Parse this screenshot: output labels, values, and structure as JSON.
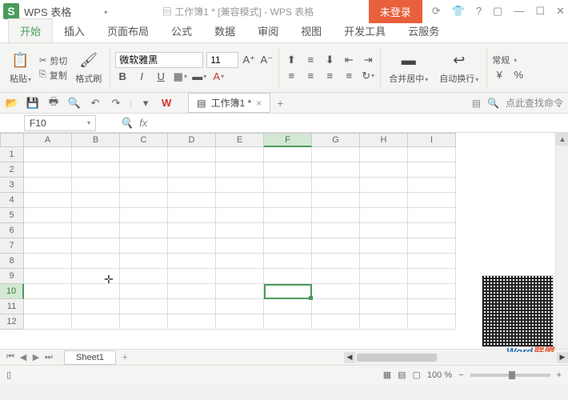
{
  "title": {
    "app": "WPS 表格",
    "doc": "工作簿1 * [兼容模式] - WPS 表格",
    "login": "未登录"
  },
  "menus": [
    "开始",
    "插入",
    "页面布局",
    "公式",
    "数据",
    "审阅",
    "视图",
    "开发工具",
    "云服务"
  ],
  "ribbon": {
    "paste": "粘贴",
    "cut": "剪切",
    "copy": "复制",
    "format_painter": "格式刷",
    "font_name": "微软雅黑",
    "font_size": "11",
    "merge": "合并居中",
    "wrap": "自动换行",
    "number_fmt": "常规"
  },
  "qa": {
    "doc_tab": "工作簿1 *",
    "search_hint": "点此查找命令"
  },
  "formula": {
    "name_box": "F10",
    "fx": "fx"
  },
  "grid": {
    "cols": [
      "A",
      "B",
      "C",
      "D",
      "E",
      "F",
      "G",
      "H",
      "I"
    ],
    "rows": [
      "1",
      "2",
      "3",
      "4",
      "5",
      "6",
      "7",
      "8",
      "9",
      "10",
      "11",
      "12"
    ],
    "active_col": 5,
    "active_row": 9
  },
  "sheet": {
    "name": "Sheet1"
  },
  "status": {
    "zoom": "100 %"
  },
  "watermark": {
    "a": "Word",
    "b": "联盟"
  }
}
